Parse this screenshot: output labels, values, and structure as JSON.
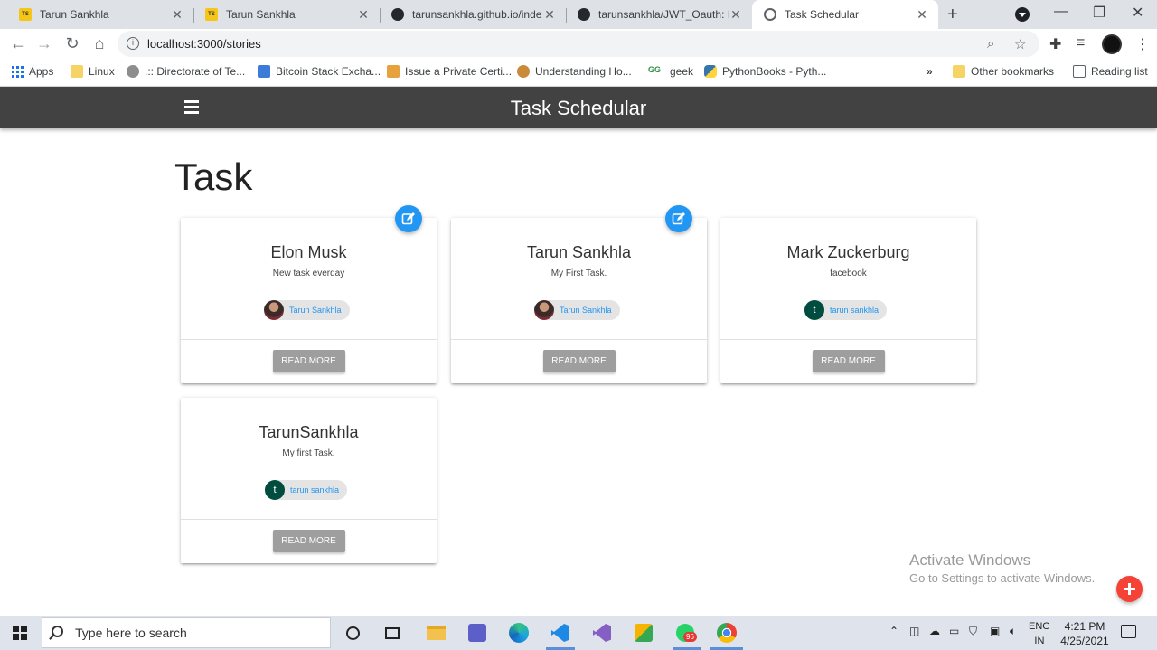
{
  "browser": {
    "tabs": [
      {
        "title": "Tarun Sankhla",
        "favicon": "ts-icon"
      },
      {
        "title": "Tarun Sankhla",
        "favicon": "ts-icon"
      },
      {
        "title": "tarunsankhla.github.io/index.h",
        "favicon": "github-icon"
      },
      {
        "title": "tarunsankhla/JWT_Oauth: I w",
        "favicon": "github-icon"
      },
      {
        "title": "Task Schedular",
        "favicon": "globe-icon",
        "active": true
      }
    ],
    "new_tab": "+",
    "url": "localhost:3000/stories",
    "bookmarks": [
      {
        "label": "Apps"
      },
      {
        "label": "Linux"
      },
      {
        "label": ".:: Directorate of Te..."
      },
      {
        "label": "Bitcoin Stack Excha..."
      },
      {
        "label": "Issue a Private Certi..."
      },
      {
        "label": "Understanding Ho..."
      },
      {
        "label": "geek"
      },
      {
        "label": "PythonBooks - Pyth..."
      }
    ],
    "bookmarks_overflow": "»",
    "other_bookmarks": "Other bookmarks",
    "reading_list": "Reading list"
  },
  "app": {
    "title": "Task Schedular",
    "heading": "Task",
    "read_more": "READ MORE",
    "cards": [
      {
        "title": "Elon Musk",
        "body": "New task everday",
        "user": "Tarun Sankhla",
        "avatar": "photo",
        "editable": true
      },
      {
        "title": "Tarun Sankhla",
        "body": "My First Task.",
        "user": "Tarun Sankhla",
        "avatar": "photo",
        "editable": true
      },
      {
        "title": "Mark Zuckerburg",
        "body": "facebook",
        "user": "tarun sankhla",
        "avatar": "letter",
        "initial": "t",
        "editable": false
      },
      {
        "title": "TarunSankhla",
        "body": "My first Task.",
        "user": "tarun sankhla",
        "avatar": "letter",
        "initial": "t",
        "editable": false
      }
    ]
  },
  "watermark": {
    "line1": "Activate Windows",
    "line2": "Go to Settings to activate Windows."
  },
  "taskbar": {
    "search_placeholder": "Type here to search",
    "lang_top": "ENG",
    "lang_bottom": "IN",
    "time": "4:21 PM",
    "date": "4/25/2021",
    "whatsapp_badge": "96"
  },
  "colors": {
    "appbar": "#424242",
    "edit_fab": "#2196f3",
    "add_fab": "#f44336",
    "read_more_btn": "#9e9e9e",
    "chip_text": "#2196f3"
  }
}
